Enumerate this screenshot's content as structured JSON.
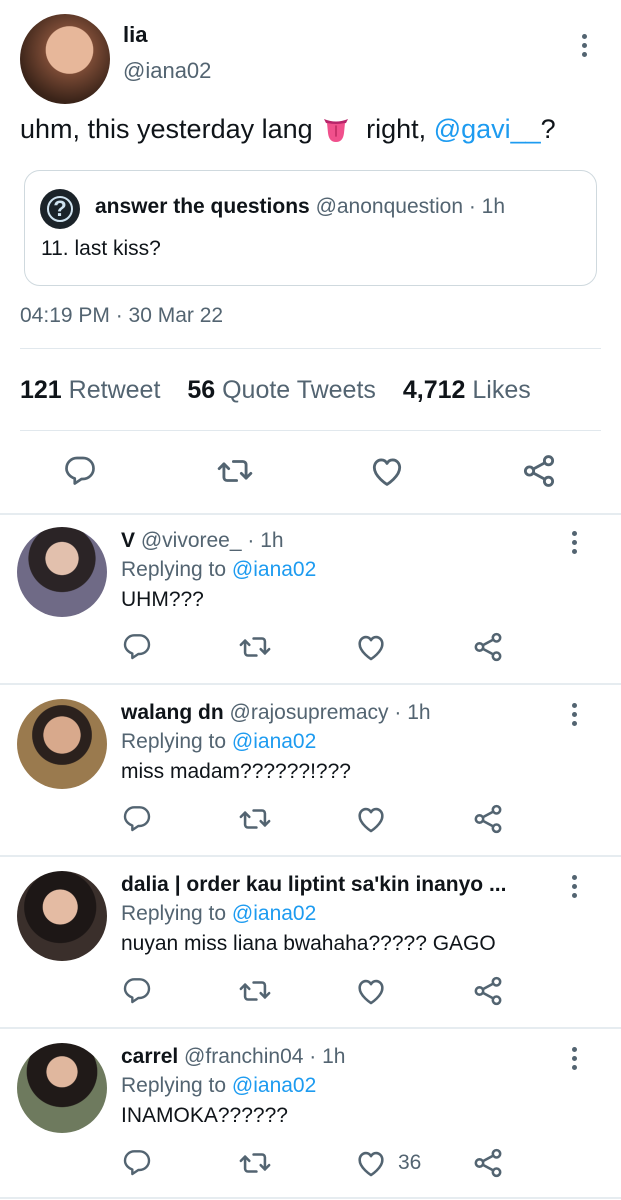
{
  "main_tweet": {
    "name": "lia",
    "handle": "@iana02",
    "text_before": "uhm, this yesterday lang",
    "text_after": " right, ",
    "mention": "@gavi__",
    "text_end": "?",
    "quote": {
      "name": "answer the questions",
      "handle": "@anonquestion",
      "time": " · 1h",
      "text": "11. last kiss?"
    },
    "timestamp": "04:19 PM · 30 Mar 22",
    "stats": {
      "retweets_count": "121",
      "retweets_label": "Retweet",
      "quotes_count": "56",
      "quotes_label": "Quote Tweets",
      "likes_count": "4,712",
      "likes_label": "Likes"
    }
  },
  "replies": [
    {
      "name": "V",
      "handle": " @vivoree_",
      "time": " · 1h",
      "replying_prefix": "Replying to ",
      "replying_to": "@iana02",
      "text": "UHM???",
      "like_count": ""
    },
    {
      "name": "walang dn",
      "handle": " @rajosupremacy",
      "time": " · 1h",
      "replying_prefix": "Replying to ",
      "replying_to": "@iana02",
      "text": "miss madam??????!???",
      "like_count": ""
    },
    {
      "name": "dalia | order kau liptint sa'kin inanyo ...",
      "handle": "",
      "time": "",
      "replying_prefix": "Replying to ",
      "replying_to": "@iana02",
      "text": "nuyan miss liana bwahaha????? GAGO",
      "like_count": ""
    },
    {
      "name": "carrel",
      "handle": " @franchin04",
      "time": " · 1h",
      "replying_prefix": "Replying to ",
      "replying_to": "@iana02",
      "text": "INAMOKA??????",
      "like_count": "36"
    }
  ],
  "colors": {
    "accent": "#1d9bf0",
    "text_primary": "#0f1419",
    "text_secondary": "#536471",
    "divider": "#e6ecf0"
  },
  "icons": [
    "more-options-icon",
    "tongue-emoji-icon",
    "question-icon",
    "reply-icon",
    "retweet-icon",
    "like-icon",
    "share-icon"
  ]
}
